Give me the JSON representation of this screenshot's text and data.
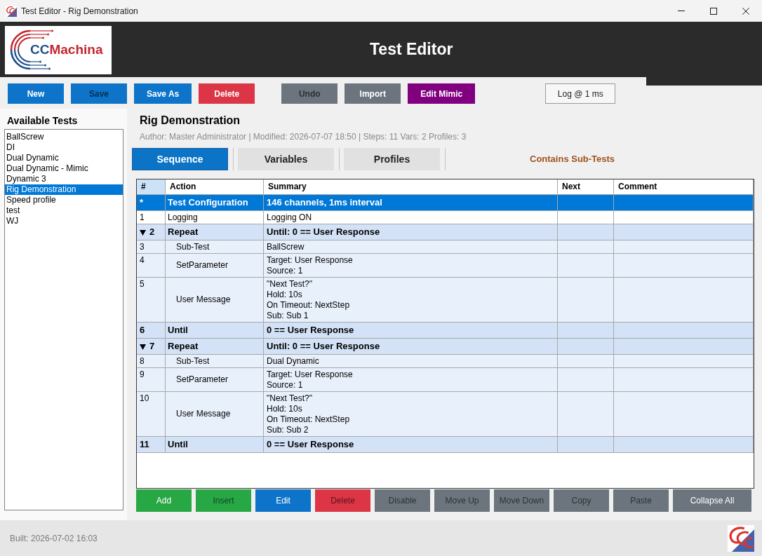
{
  "window": {
    "title": "Test Editor - Rig Demonstration"
  },
  "header": {
    "logo": {
      "prefix": "CC",
      "name": "Machina"
    },
    "title": "Test Editor"
  },
  "toolbar": {
    "file_buttons": [
      {
        "label": "New",
        "color": "#0d74c9",
        "disabled": false
      },
      {
        "label": "Save",
        "color": "#0d74c9",
        "disabled": true
      },
      {
        "label": "Save As",
        "color": "#0d74c9",
        "disabled": false
      },
      {
        "label": "Delete",
        "color": "#dc3545",
        "disabled": false
      }
    ],
    "edit_buttons": [
      {
        "label": "Undo",
        "color": "#6c757d",
        "disabled": true
      },
      {
        "label": "Import",
        "color": "#6c757d",
        "disabled": false
      },
      {
        "label": "Edit Mimic",
        "color": "#800080",
        "disabled": false
      }
    ],
    "log_button": {
      "label": "Log @ 1 ms"
    }
  },
  "sidebar": {
    "title": "Available Tests",
    "items": [
      {
        "label": "BallScrew",
        "selected": false
      },
      {
        "label": "DI",
        "selected": false
      },
      {
        "label": "Dual Dynamic",
        "selected": false
      },
      {
        "label": "Dual Dynamic - Mimic",
        "selected": false
      },
      {
        "label": "Dynamic 3",
        "selected": false
      },
      {
        "label": "Rig Demonstration",
        "selected": true
      },
      {
        "label": "Speed profile",
        "selected": false
      },
      {
        "label": "test",
        "selected": false
      },
      {
        "label": "WJ",
        "selected": false
      }
    ]
  },
  "editor": {
    "title": "Rig Demonstration",
    "meta": "Author: Master Administrator | Modified: 2026-07-07 18:50 | Steps: 11 Vars: 2 Profiles: 3",
    "tabs": [
      {
        "label": "Sequence",
        "selected": true
      },
      {
        "label": "Variables",
        "selected": false
      },
      {
        "label": "Profiles",
        "selected": false
      }
    ],
    "notice": "Contains Sub-Tests"
  },
  "table": {
    "columns": [
      {
        "label": "#",
        "highlighted": true
      },
      {
        "label": "Action",
        "highlighted": false
      },
      {
        "label": "Summary",
        "highlighted": false
      },
      {
        "label": "Next",
        "highlighted": false
      },
      {
        "label": "Comment",
        "highlighted": false
      }
    ],
    "rows": [
      {
        "kind": "config",
        "number": "*",
        "action": "Test Configuration",
        "summary": "146 channels, 1ms interval",
        "selected": true
      },
      {
        "kind": "step",
        "number": "1",
        "action": "Logging",
        "summary": "Logging ON",
        "selected": false
      },
      {
        "kind": "block",
        "number": "2",
        "action": "Repeat",
        "summary": "Until: 0 == User Response",
        "expanded": true,
        "selected": false,
        "children": [
          {
            "kind": "step",
            "number": "3",
            "action": "Sub-Test",
            "summary": "BallScrew",
            "selected": false
          },
          {
            "kind": "step",
            "number": "4",
            "action": "SetParameter",
            "summary": "Target: User Response\nSource: 1",
            "selected": false
          },
          {
            "kind": "step",
            "number": "5",
            "action": "User Message",
            "summary": "\"Next Test?\"\nHold: 10s\nOn Timeout: NextStep\nSub: Sub 1",
            "selected": false
          }
        ]
      },
      {
        "kind": "end",
        "number": "6",
        "action": "Until",
        "summary": "0 == User Response",
        "selected": false
      },
      {
        "kind": "block",
        "number": "7",
        "action": "Repeat",
        "summary": "Until: 0 == User Response",
        "expanded": true,
        "selected": false,
        "children": [
          {
            "kind": "step",
            "number": "8",
            "action": "Sub-Test",
            "summary": "Dual Dynamic",
            "selected": false
          },
          {
            "kind": "step",
            "number": "9",
            "action": "SetParameter",
            "summary": "Target: User Response\nSource: 1",
            "selected": false
          },
          {
            "kind": "step",
            "number": "10",
            "action": "User Message",
            "summary": "\"Next Test?\"\nHold: 10s\nOn Timeout: NextStep\nSub: Sub 2",
            "selected": false
          }
        ]
      },
      {
        "kind": "end",
        "number": "11",
        "action": "Until",
        "summary": "0 == User Response",
        "selected": false
      }
    ]
  },
  "table_actions": [
    {
      "label": "Add",
      "color": "#28a745",
      "disabled": false
    },
    {
      "label": "Insert",
      "color": "#28a745",
      "disabled": true
    },
    {
      "label": "Edit",
      "color": "#0d74c9",
      "disabled": false
    },
    {
      "label": "Delete",
      "color": "#dc3545",
      "disabled": true
    },
    {
      "label": "Disable",
      "color": "#6c757d",
      "disabled": true
    },
    {
      "label": "Move Up",
      "color": "#6c757d",
      "disabled": true
    },
    {
      "label": "Move Down",
      "color": "#6c757d",
      "disabled": true
    },
    {
      "label": "Copy",
      "color": "#6c757d",
      "disabled": true
    },
    {
      "label": "Paste",
      "color": "#6c757d",
      "disabled": true
    },
    {
      "label": "Collapse All",
      "color": "#6c757d",
      "disabled": false
    }
  ],
  "status_bar": {
    "build": "Built: 2026-07-02 16:03"
  }
}
